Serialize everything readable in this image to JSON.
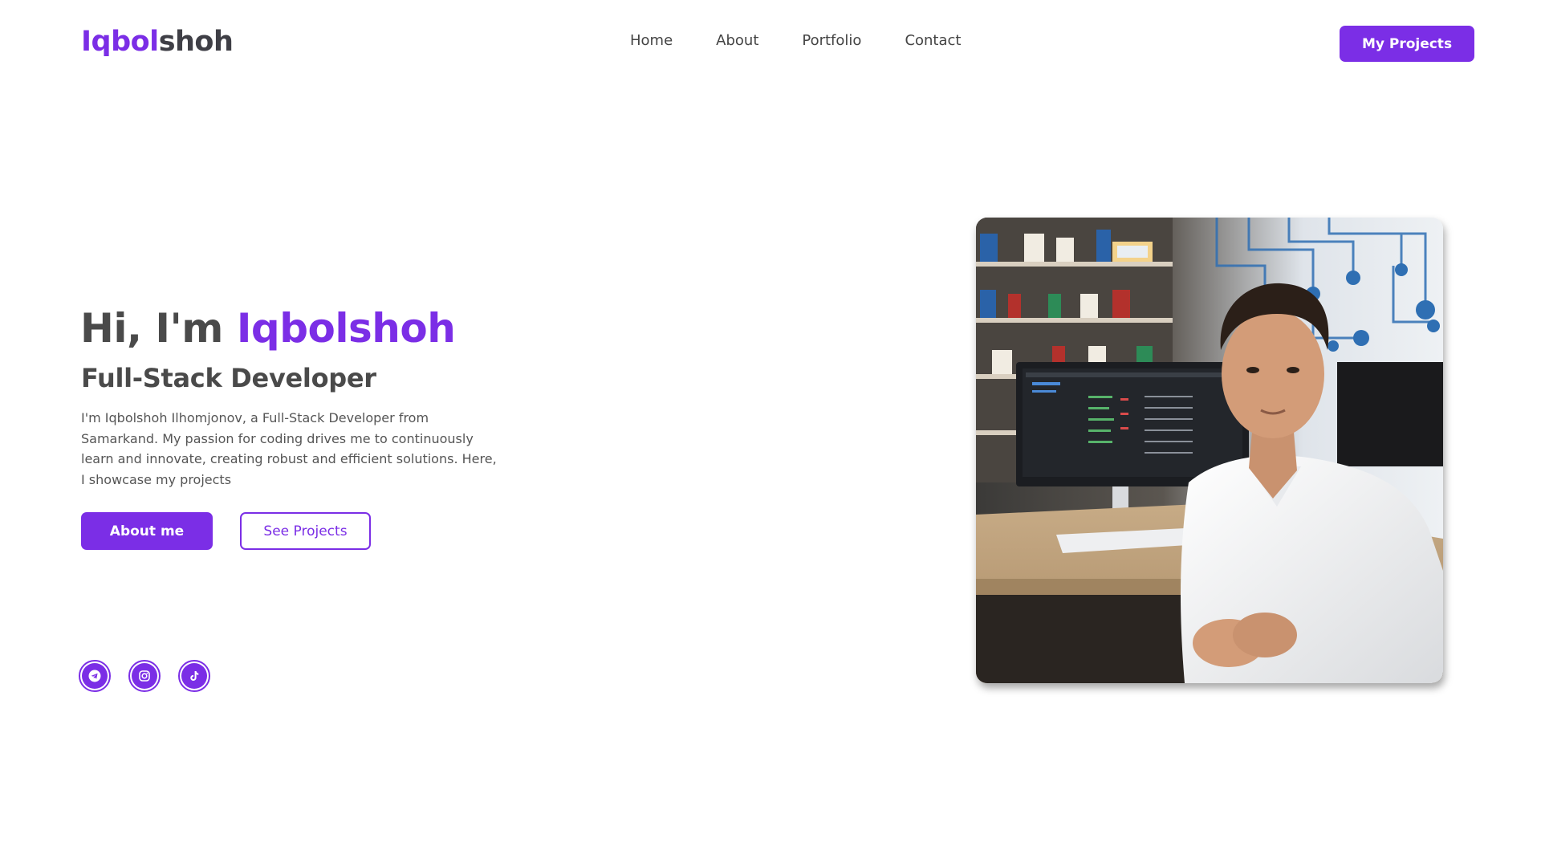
{
  "header": {
    "logo_accent": "Iqbol",
    "logo_rest": "shoh",
    "nav": [
      "Home",
      "About",
      "Portfolio",
      "Contact"
    ],
    "cta_label": "My Projects"
  },
  "hero": {
    "greeting": "Hi, I'm ",
    "name": "Iqbolshoh",
    "subtitle": "Full-Stack Developer",
    "description": "I'm Iqbolshoh Ilhomjonov, a Full-Stack Developer from Samarkand. My passion for coding drives me to continuously learn and innovate, creating robust and efficient solutions. Here, I showcase my projects",
    "primary_button": "About me",
    "secondary_button": "See Projects"
  },
  "socials": [
    {
      "icon": "telegram-icon"
    },
    {
      "icon": "instagram-icon"
    },
    {
      "icon": "tiktok-icon"
    }
  ],
  "colors": {
    "accent": "#7b2ee6",
    "text": "#4a4a4a"
  }
}
